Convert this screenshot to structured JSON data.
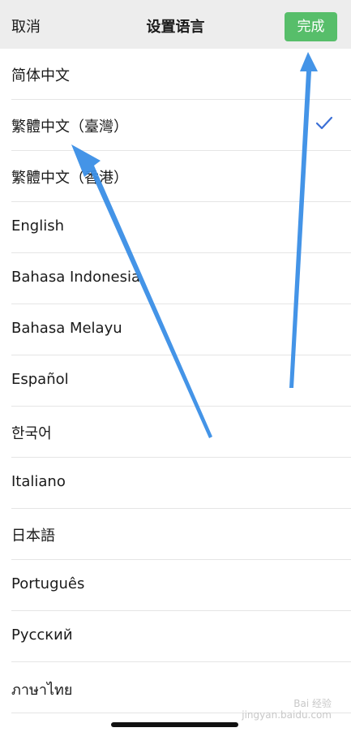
{
  "header": {
    "cancel_label": "取消",
    "title": "设置语言",
    "done_label": "完成"
  },
  "languages": [
    {
      "label": "简体中文",
      "selected": false
    },
    {
      "label": "繁體中文（臺灣）",
      "selected": true
    },
    {
      "label": "繁體中文（香港）",
      "selected": false
    },
    {
      "label": "English",
      "selected": false
    },
    {
      "label": "Bahasa Indonesia",
      "selected": false
    },
    {
      "label": "Bahasa Melayu",
      "selected": false
    },
    {
      "label": "Español",
      "selected": false
    },
    {
      "label": "한국어",
      "selected": false
    },
    {
      "label": "Italiano",
      "selected": false
    },
    {
      "label": "日本語",
      "selected": false
    },
    {
      "label": "Português",
      "selected": false
    },
    {
      "label": "Русский",
      "selected": false
    },
    {
      "label": "ภาษาไทย",
      "selected": false
    }
  ],
  "watermark": "Bai 经验\njingyan.baidu.com",
  "colors": {
    "done_button": "#57be6a",
    "checkmark": "#3b6fd6",
    "annotation_arrow": "#3a8ee6"
  },
  "icons": {
    "checkmark": "check-icon"
  }
}
